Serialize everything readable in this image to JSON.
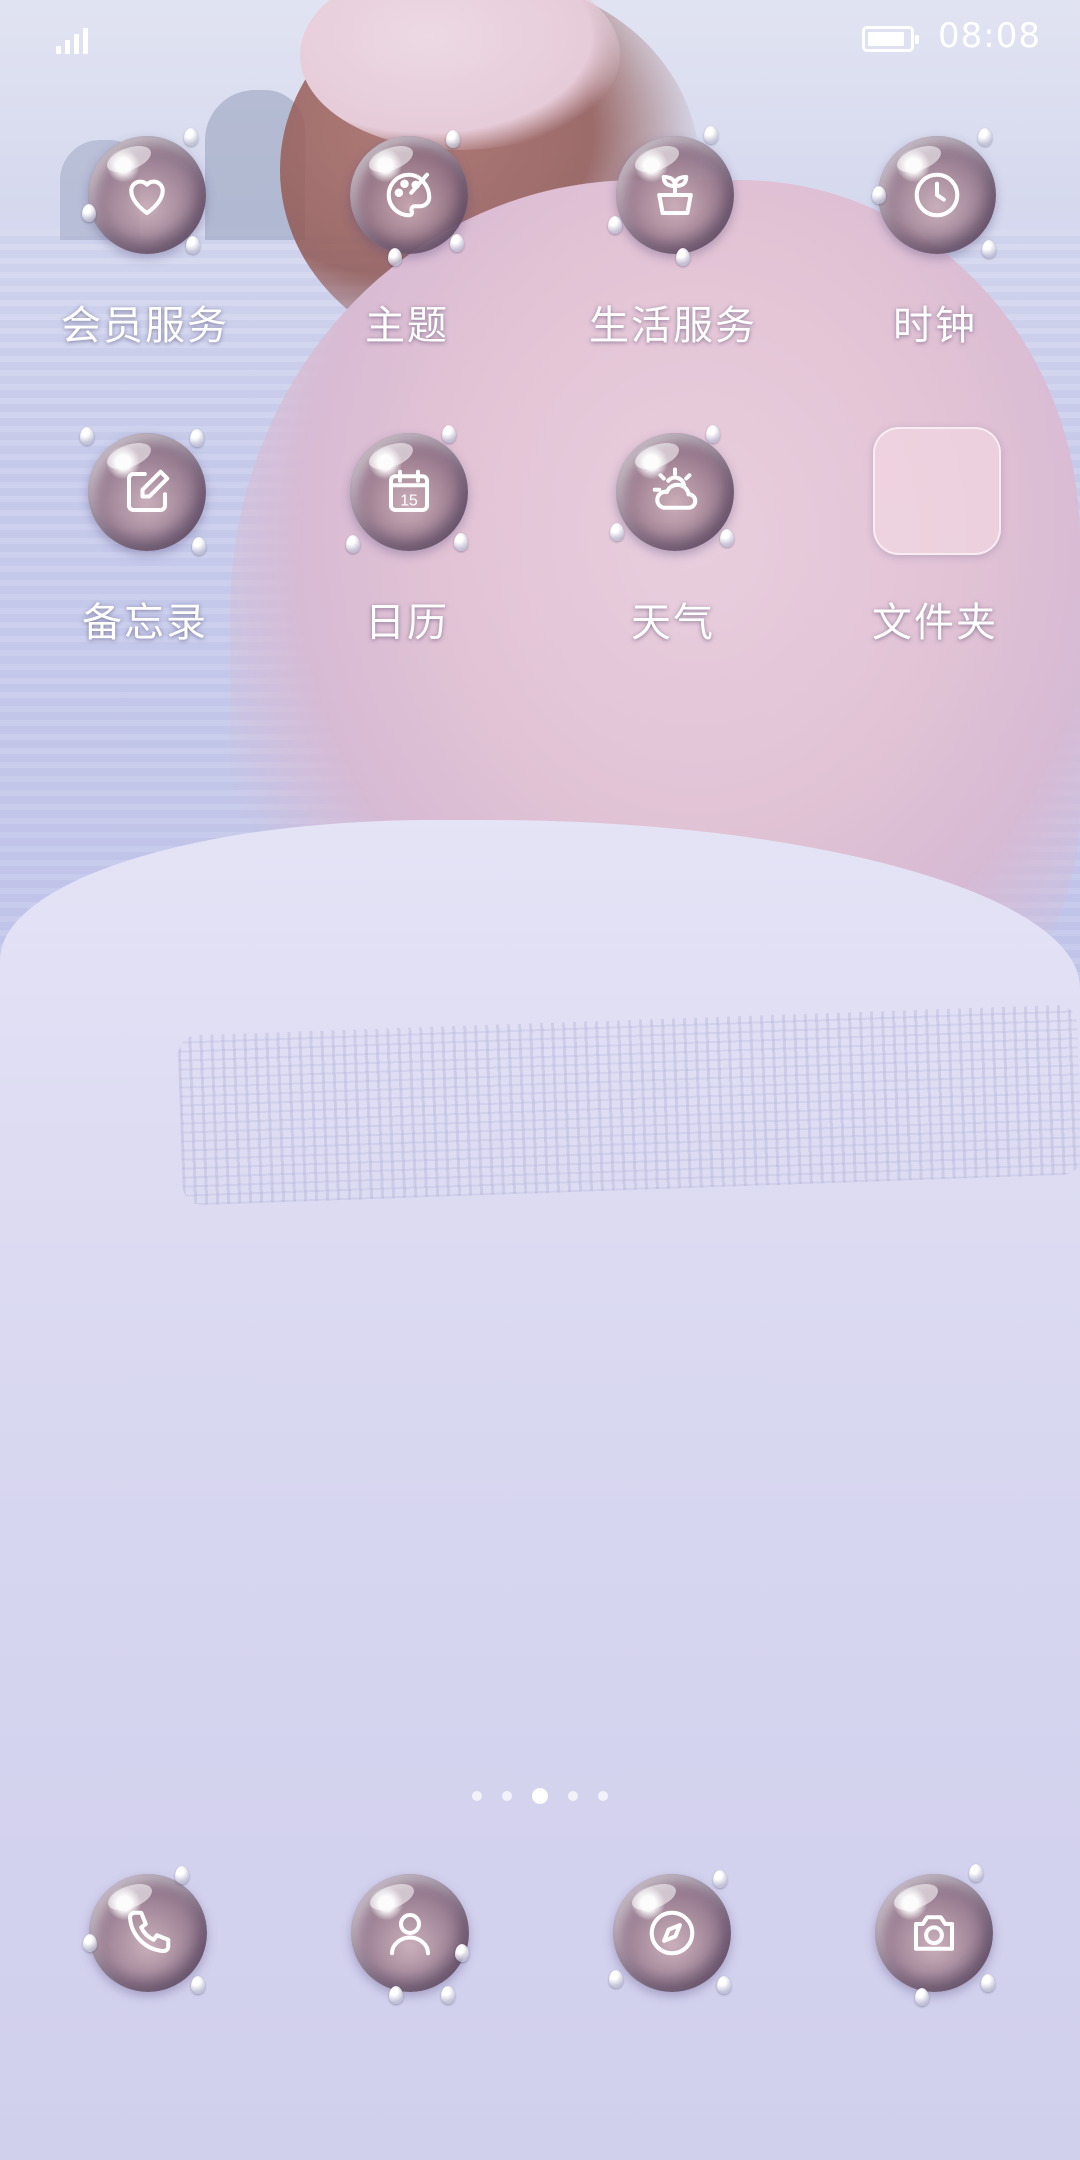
{
  "status_bar": {
    "time": "08:08",
    "battery_level": 0.9,
    "signal_bars": 4
  },
  "apps": [
    {
      "label": "会员服务",
      "icon": "heart-icon"
    },
    {
      "label": "主题",
      "icon": "palette-icon"
    },
    {
      "label": "生活服务",
      "icon": "sprout-icon"
    },
    {
      "label": "时钟",
      "icon": "clock-icon"
    },
    {
      "label": "备忘录",
      "icon": "note-edit-icon"
    },
    {
      "label": "日历",
      "icon": "calendar-icon",
      "badge": "15"
    },
    {
      "label": "天气",
      "icon": "weather-icon"
    },
    {
      "label": "文件夹",
      "icon": "folder-icon"
    }
  ],
  "page_indicator": {
    "count": 5,
    "active": 3
  },
  "dock": [
    {
      "icon": "phone-icon"
    },
    {
      "icon": "contacts-icon"
    },
    {
      "icon": "browser-icon"
    },
    {
      "icon": "camera-icon"
    }
  ]
}
